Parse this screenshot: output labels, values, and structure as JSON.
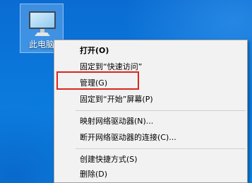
{
  "desktop": {
    "icon_label": "此电脑",
    "icon": "computer-monitor-icon"
  },
  "context_menu": {
    "items": [
      {
        "label": "打开(O)"
      },
      {
        "label": "固定到“快速访问”"
      },
      {
        "label": "管理(G)"
      },
      {
        "label": "固定到“开始”屏幕(P)"
      },
      {
        "label": "映射网络驱动器(N)..."
      },
      {
        "label": "断开网络驱动器的连接(C)..."
      },
      {
        "label": "创建快捷方式(S)"
      },
      {
        "label": "删除(D)"
      }
    ]
  },
  "colors": {
    "highlight": "#d9261c",
    "menu_background": "#f2f2f2",
    "desktop_background": "#0b78dc"
  }
}
